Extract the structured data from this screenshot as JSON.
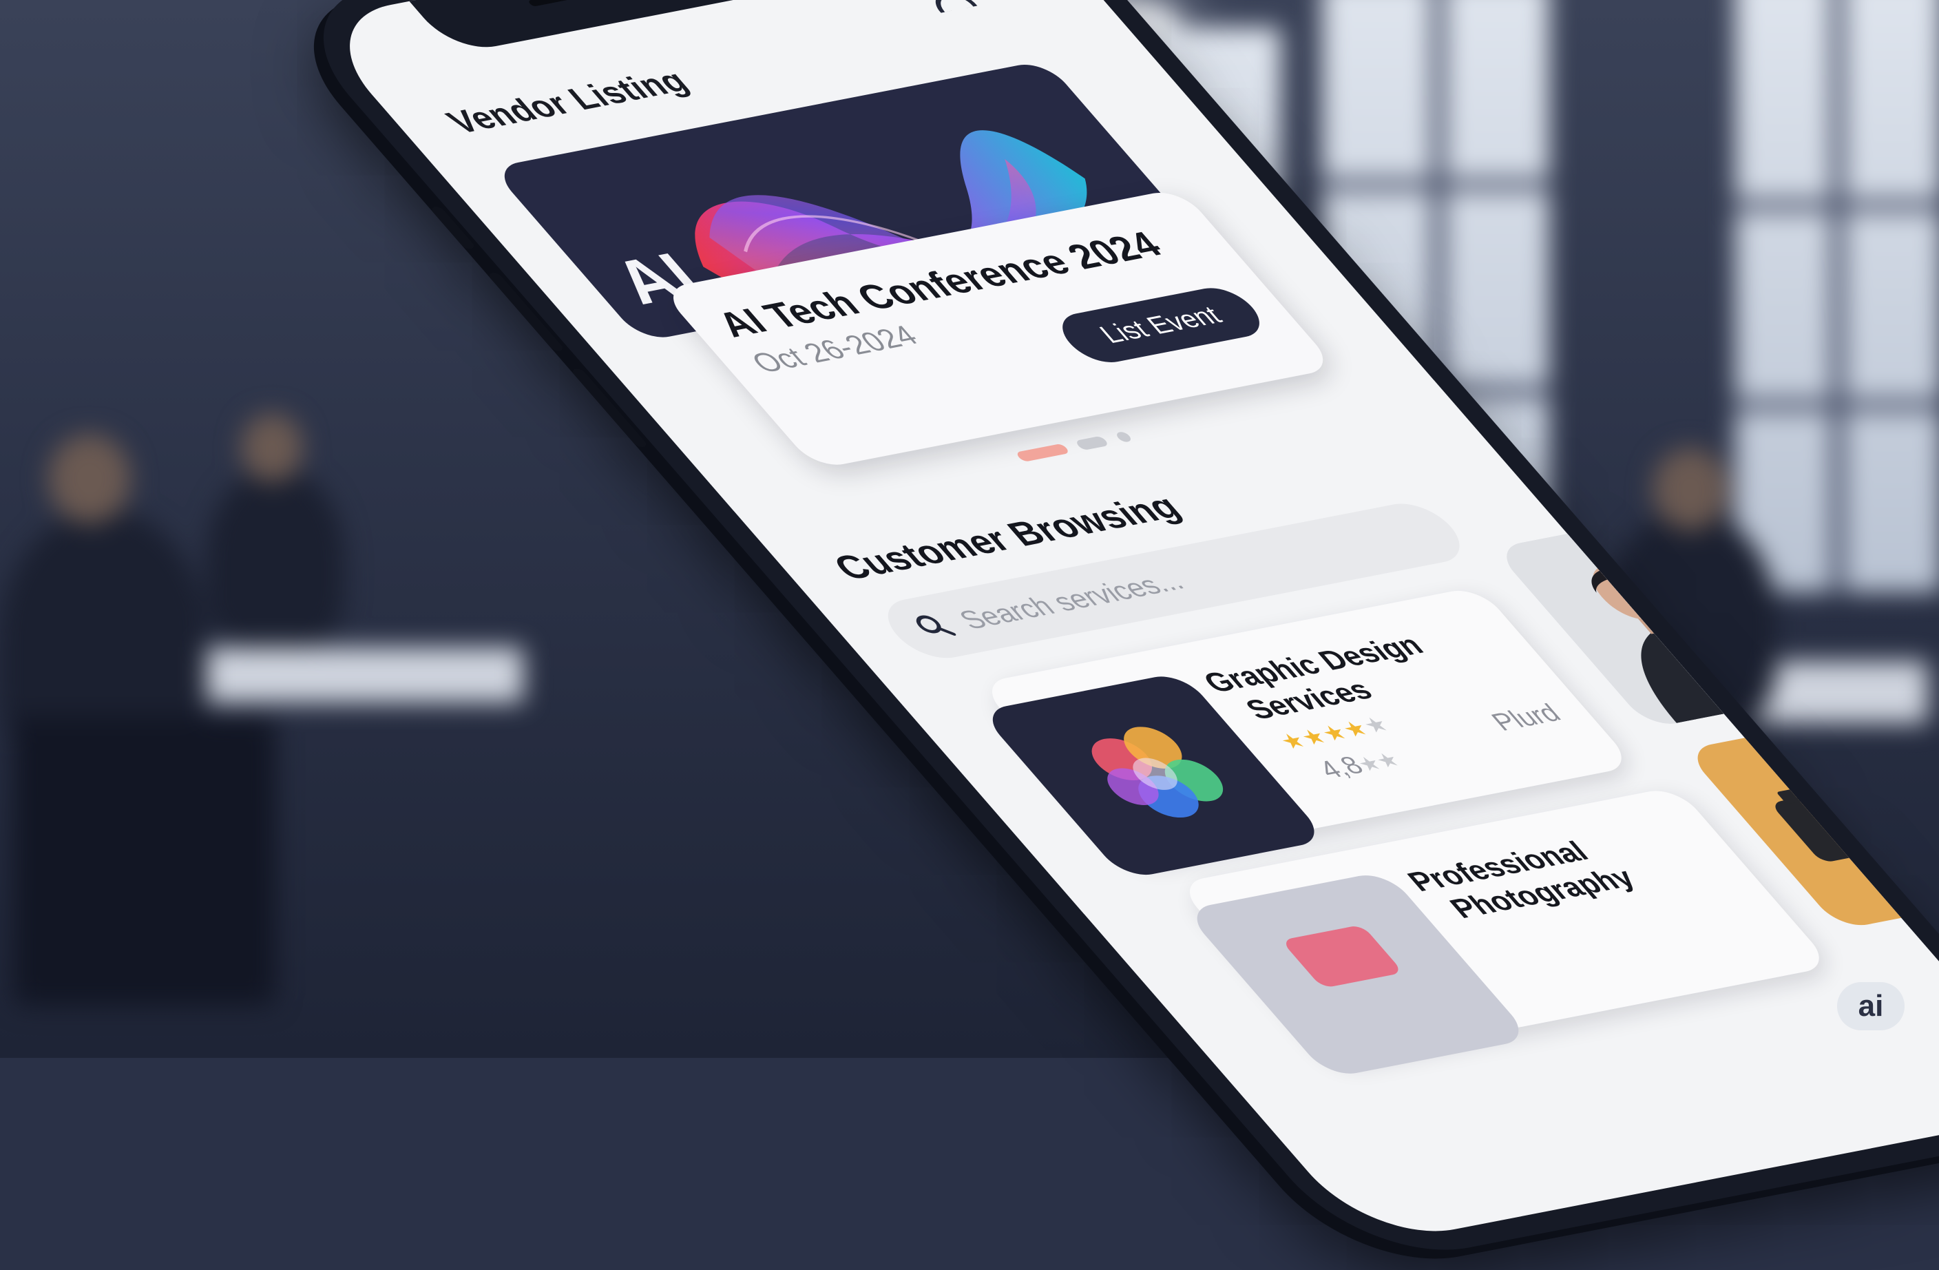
{
  "app": {
    "title": "Vendor Listing",
    "profile_icon": "profile-icon",
    "notification_color": "#e8534a"
  },
  "hero": {
    "logo_text": "AI",
    "background_color": "#262944"
  },
  "event": {
    "name": "AI Tech Conference 2024",
    "date": "Oct 26-2024",
    "button_label": "List Event"
  },
  "carousel": {
    "page_count": 3,
    "active_index": 0,
    "active_color": "#f2a59b",
    "inactive_color": "#c9cbd1"
  },
  "browse": {
    "heading": "Customer Browsing",
    "search_placeholder": "Search services..."
  },
  "services": [
    {
      "title_line1": "Graphic Design",
      "title_line2": "Services",
      "stars_filled": "★★★★",
      "stars_empty": "★",
      "rating_text": "4,8",
      "rating_stars": "★★",
      "tag": "Plurd",
      "icon": "flower-logo-icon"
    },
    {
      "title_line1": "Professional",
      "title_line2": "Photography",
      "icon": "photo-app-icon"
    }
  ],
  "side_cards": {
    "portrait_icon": "portrait-photo",
    "camera_icon": "camera-icon",
    "camera_bg": "#e3a955"
  },
  "badge": {
    "label": "ai"
  },
  "colors": {
    "accent_dark": "#24283f",
    "star_gold": "#f2b731",
    "star_gray": "#c7c9ce"
  }
}
